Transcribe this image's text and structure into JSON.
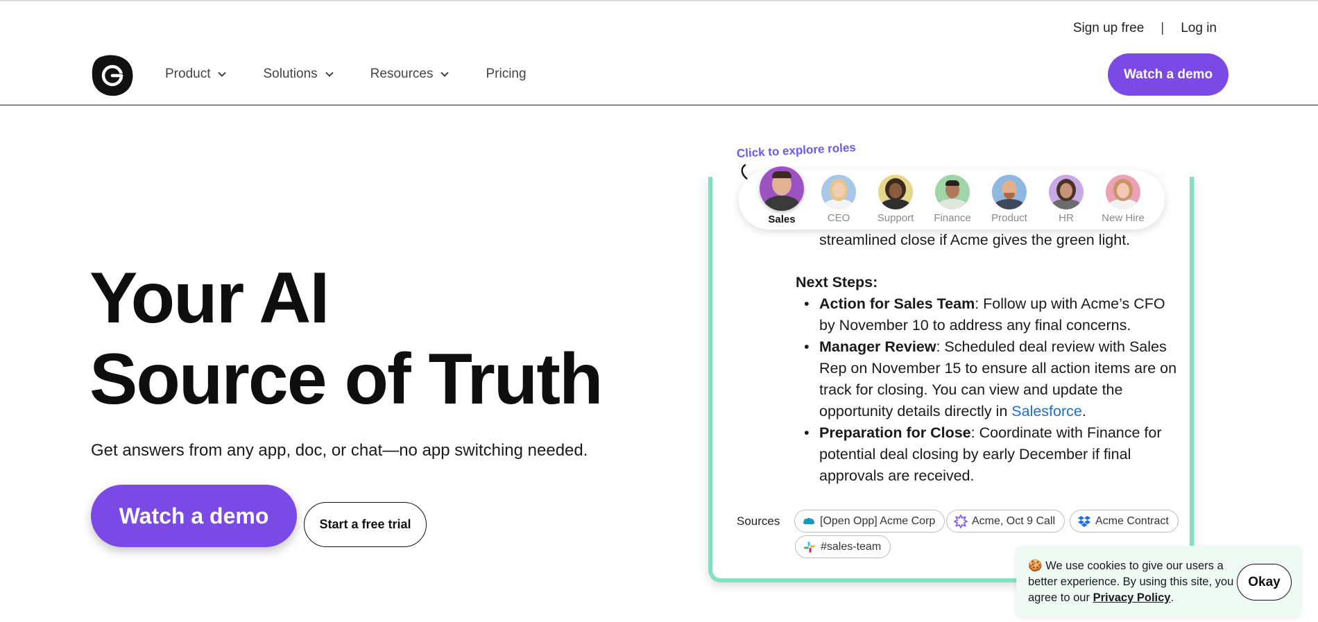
{
  "header": {
    "signup_label": "Sign up free",
    "separator": "|",
    "login_label": "Log in",
    "demo_label": "Watch a demo",
    "nav": [
      {
        "label": "Product",
        "has_dropdown": true
      },
      {
        "label": "Solutions",
        "has_dropdown": true
      },
      {
        "label": "Resources",
        "has_dropdown": true
      },
      {
        "label": "Pricing",
        "has_dropdown": false
      }
    ]
  },
  "hero": {
    "title_line1": "Your AI",
    "title_line2": "Source of Truth",
    "subtitle": "Get answers from any app, doc, or chat—no app switching needed.",
    "demo_label": "Watch a demo",
    "trial_label": "Start a free trial"
  },
  "roles": {
    "hint": "Click to explore roles",
    "items": [
      {
        "label": "Sales",
        "active": true
      },
      {
        "label": "CEO",
        "active": false
      },
      {
        "label": "Support",
        "active": false
      },
      {
        "label": "Finance",
        "active": false
      },
      {
        "label": "Product",
        "active": false
      },
      {
        "label": "HR",
        "active": false
      },
      {
        "label": "New Hire",
        "active": false
      }
    ]
  },
  "answer": {
    "continued_text": "streamlined close if Acme gives the green light.",
    "next_steps_heading": "Next Steps:",
    "bullets": [
      {
        "bold": "Action for Sales Team",
        "text": ": Follow up with Acme’s CFO by November 10 to address any final concerns."
      },
      {
        "bold": "Manager Review",
        "text": ": Scheduled deal review with Sales Rep on November 15 to ensure all action items are on track for closing. You can view and update the opportunity details directly in ",
        "link": "Salesforce",
        "after": "."
      },
      {
        "bold": "Preparation for Close",
        "text": ": Coordinate with Finance for potential deal closing by early December if final approvals are received."
      }
    ],
    "sources_label": "Sources",
    "sources": [
      {
        "label": "[Open Opp] Acme Corp",
        "icon": "salesforce-icon"
      },
      {
        "label": "Acme, Oct 9 Call",
        "icon": "gong-icon"
      },
      {
        "label": "Acme Contract",
        "icon": "dropbox-icon"
      },
      {
        "label": "#sales-team",
        "icon": "slack-icon"
      }
    ]
  },
  "cookie": {
    "emoji": "🍪",
    "text": " We use cookies to give our users a better experience.  By using this site, you agree to our ",
    "policy_label": "Privacy Policy",
    "after": ".",
    "ok_label": "Okay"
  },
  "colors": {
    "brand_purple": "#7b4ae6",
    "card_border": "#7fe3bf",
    "link_blue": "#1a6ed8",
    "cookie_bg": "#effaf5"
  }
}
